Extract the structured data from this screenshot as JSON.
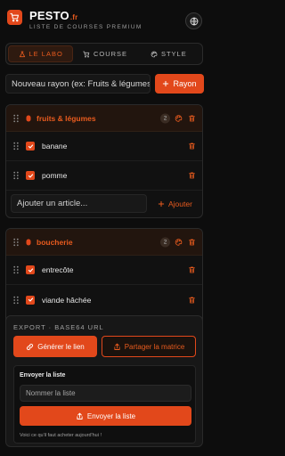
{
  "header": {
    "brand": "PESTO",
    "brand_tld": ".fr",
    "tagline": "LISTE DE COURSES PREMIUM",
    "icons": {
      "logo": "cart-icon",
      "language": "globe-icon"
    }
  },
  "tabs": [
    {
      "label": "LE LABO",
      "icon": "flask-icon",
      "active": true
    },
    {
      "label": "COURSE",
      "icon": "cart-icon",
      "active": false
    },
    {
      "label": "STYLE",
      "icon": "palette-icon",
      "active": false
    }
  ],
  "new_rayon": {
    "placeholder": "Nouveau rayon (ex: Fruits & légumes)",
    "button_label": "Rayon"
  },
  "categories": [
    {
      "name": "fruits & légumes",
      "count": "2",
      "items": [
        {
          "name": "banane",
          "checked": true
        },
        {
          "name": "pomme",
          "checked": true
        }
      ],
      "add_placeholder": "Ajouter un article...",
      "add_label": "Ajouter"
    },
    {
      "name": "boucherie",
      "count": "2",
      "items": [
        {
          "name": "entrecôte",
          "checked": true
        },
        {
          "name": "viande hâchée",
          "checked": true
        }
      ]
    }
  ],
  "export": {
    "label": "EXPORT · BASE64 URL",
    "generate_label": "Générer le lien",
    "share_label": "Partager la matrice",
    "send_title": "Envoyer la liste",
    "list_name_placeholder": "Nommer la liste",
    "send_label": "Envoyer la liste",
    "hint": "Voici ce qu'il faut acheter aujourd'hui !"
  },
  "colors": {
    "accent": "#e2481b",
    "background": "#0d0d0d",
    "card_header": "#22150e"
  }
}
